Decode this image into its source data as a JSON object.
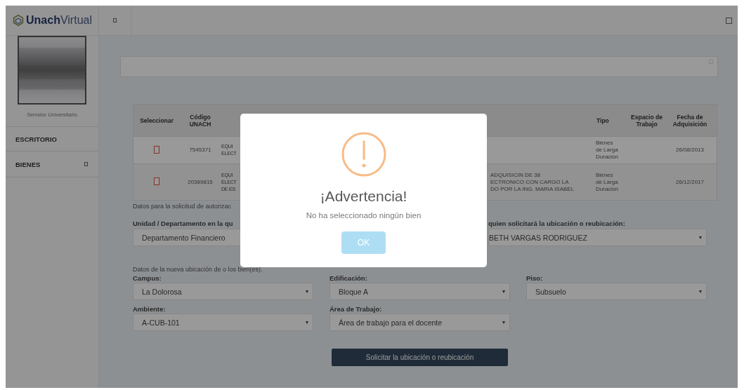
{
  "sidebar": {
    "logo_bold": "Unach",
    "logo_light": "Virtual",
    "user_role": "Servidor Universitario",
    "items": [
      {
        "label": "ESCRITORIO",
        "has_submenu": false
      },
      {
        "label": "BIENES",
        "has_submenu": true
      }
    ]
  },
  "table": {
    "header": {
      "select": "Seleccionar",
      "code": "Código UNACH",
      "tipo": "Tipo",
      "espacio": "Espacio de Trabajo",
      "fecha": "Fecha de Adquisición"
    },
    "rows": [
      {
        "checked": false,
        "code": "7545371",
        "column_3": "EQUI\nELECT",
        "tipo": "Bienes\nde Larga\nDuración",
        "fecha": "26/08/2013"
      },
      {
        "checked": false,
        "code": "20389815",
        "column_3": "EQUI\nELECT\nDE ES",
        "column_4": "ADQUISICIN DE 38\nECTRONICO CON CARGO LA\nDO POR LA ING. MARIA ISABEL",
        "tipo": "Bienes\nde Larga\nDuración",
        "fecha": "26/12/2017"
      }
    ]
  },
  "request_note": "Datos para la solicitud de autorizac",
  "unit_label": "Unidad / Departamento en la qu",
  "unit_value": "Departamento Financiero",
  "requester_label": "quien solicitará la ubicación o reubicación:",
  "requester_value": "BETH VARGAS RODRIGUEZ",
  "location_note": "Datos de la nueva ubicación de o los bien(es).",
  "location_fields": [
    {
      "label": "Campus:",
      "value": "La Dolorosa"
    },
    {
      "label": "Edificación:",
      "value": "Bloque A"
    },
    {
      "label": "Piso:",
      "value": "Subsuelo"
    },
    {
      "label": "Ambiente:",
      "value": "A-CUB-101"
    },
    {
      "label": "Área de Trabajo:",
      "value": "Área de trabajo para el docente"
    }
  ],
  "submit": "Solicitar la ubicación o reubicación",
  "dialog": {
    "title": "¡Advertencia!",
    "message": "No ha seleccionado ningún bien",
    "button": "OK"
  }
}
